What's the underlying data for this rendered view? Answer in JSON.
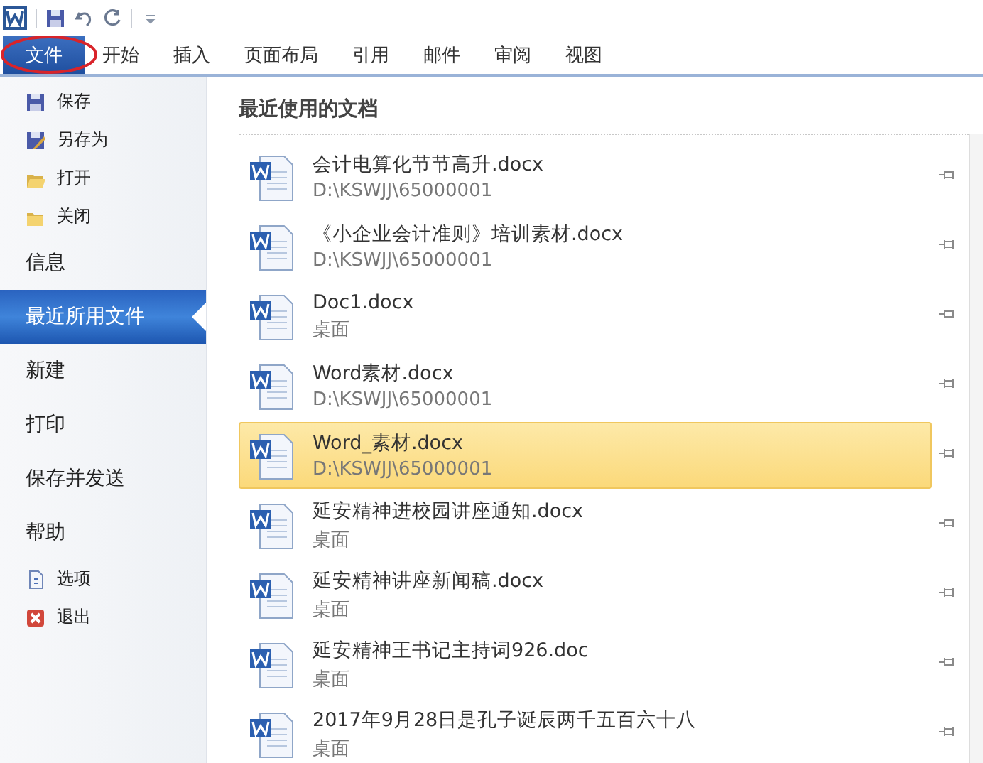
{
  "tabs": [
    {
      "label": "文件",
      "selected": true
    },
    {
      "label": "开始",
      "selected": false
    },
    {
      "label": "插入",
      "selected": false
    },
    {
      "label": "页面布局",
      "selected": false
    },
    {
      "label": "引用",
      "selected": false
    },
    {
      "label": "邮件",
      "selected": false
    },
    {
      "label": "审阅",
      "selected": false
    },
    {
      "label": "视图",
      "selected": false
    }
  ],
  "sidebar": {
    "items": [
      {
        "kind": "command",
        "label": "保存",
        "selected": false
      },
      {
        "kind": "command",
        "label": "另存为",
        "selected": false
      },
      {
        "kind": "command",
        "label": "打开",
        "selected": false
      },
      {
        "kind": "command",
        "label": "关闭",
        "selected": false
      },
      {
        "kind": "section",
        "label": "信息",
        "selected": false
      },
      {
        "kind": "section",
        "label": "最近所用文件",
        "selected": true
      },
      {
        "kind": "section",
        "label": "新建",
        "selected": false
      },
      {
        "kind": "section",
        "label": "打印",
        "selected": false
      },
      {
        "kind": "section",
        "label": "保存并发送",
        "selected": false
      },
      {
        "kind": "section",
        "label": "帮助",
        "selected": false
      },
      {
        "kind": "command",
        "label": "选项",
        "selected": false
      },
      {
        "kind": "command",
        "label": "退出",
        "selected": false
      }
    ]
  },
  "recent": {
    "heading": "最近使用的文档",
    "documents": [
      {
        "name": "会计电算化节节高升.docx",
        "location": "D:\\KSWJJ\\65000001",
        "selected": false
      },
      {
        "name": "《小企业会计准则》培训素材.docx",
        "location": "D:\\KSWJJ\\65000001",
        "selected": false
      },
      {
        "name": "Doc1.docx",
        "location": "桌面",
        "selected": false
      },
      {
        "name": "Word素材.docx",
        "location": "D:\\KSWJJ\\65000001",
        "selected": false
      },
      {
        "name": "Word_素材.docx",
        "location": "D:\\KSWJJ\\65000001",
        "selected": true
      },
      {
        "name": "延安精神进校园讲座通知.docx",
        "location": "桌面",
        "selected": false
      },
      {
        "name": "延安精神讲座新闻稿.docx",
        "location": "桌面",
        "selected": false
      },
      {
        "name": "延安精神王书记主持词926.doc",
        "location": "桌面",
        "selected": false
      },
      {
        "name": "2017年9月28日是孔子诞辰两千五百六十八",
        "location": "桌面",
        "selected": false
      }
    ]
  }
}
